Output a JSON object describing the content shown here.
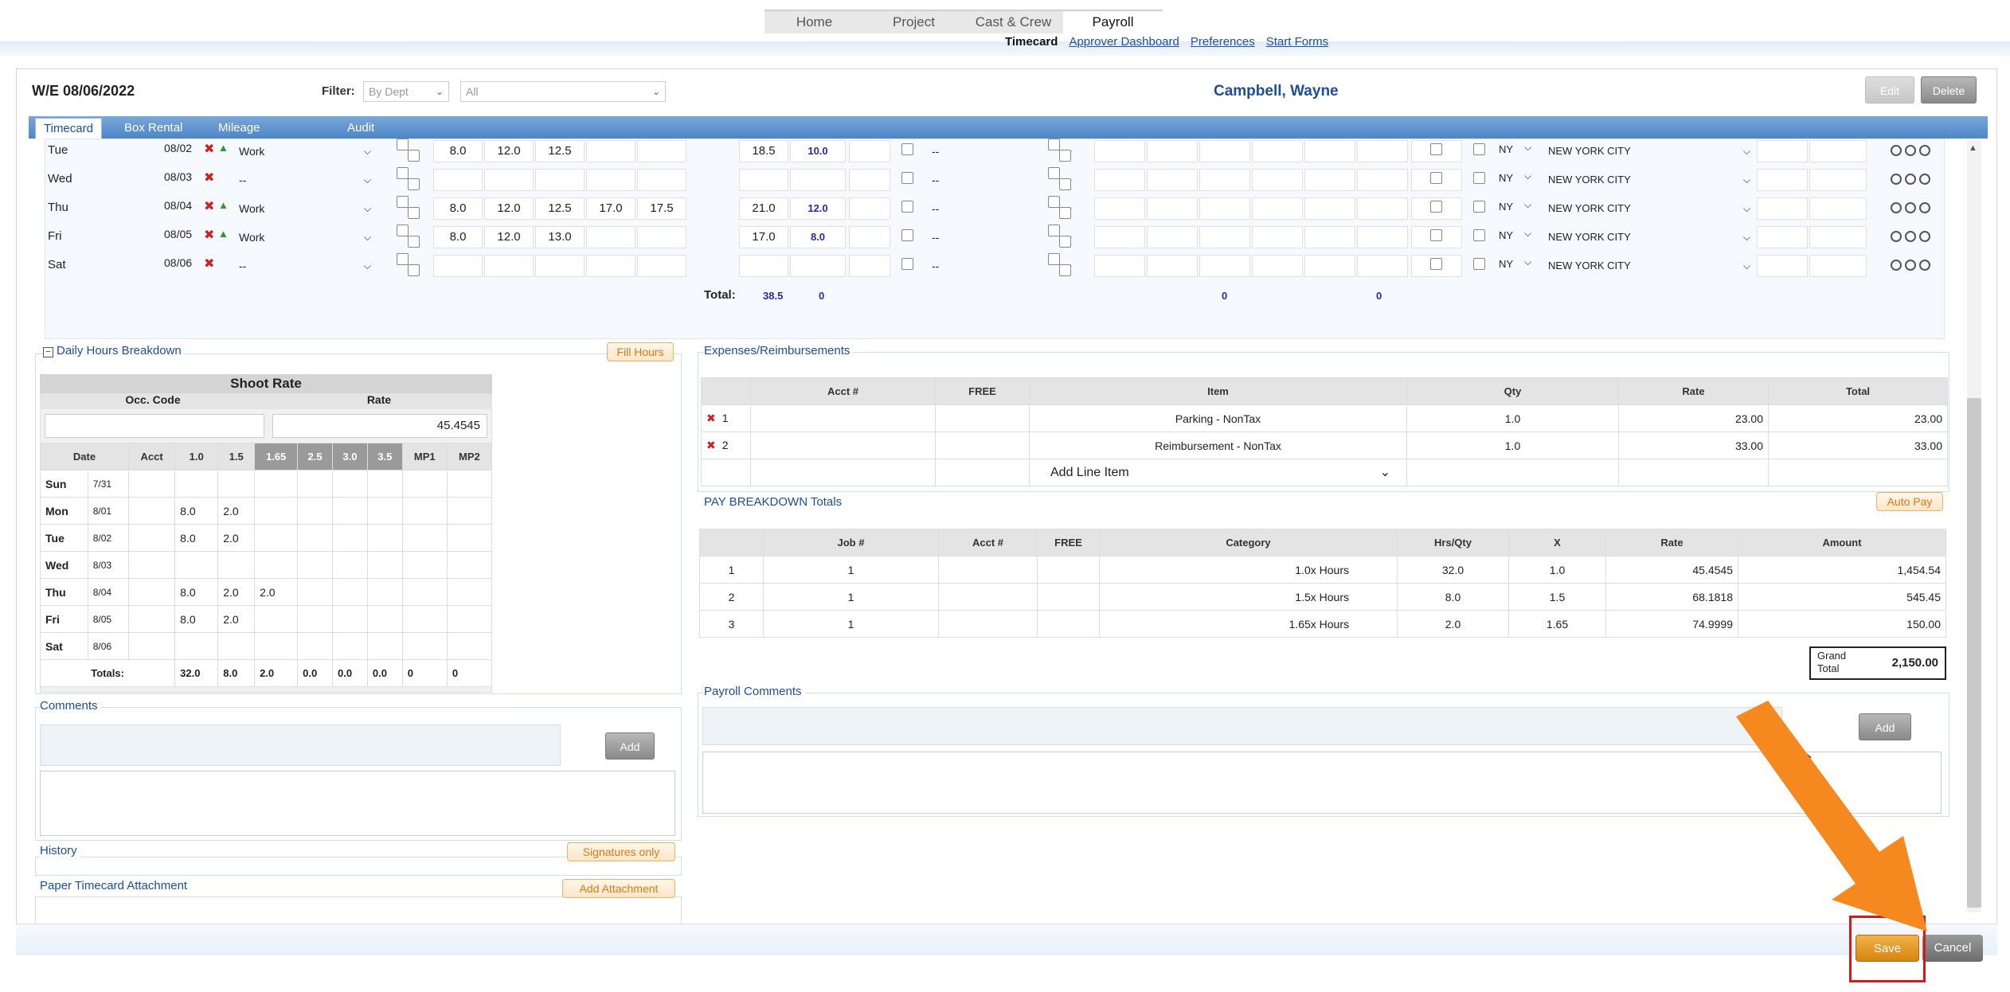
{
  "nav": {
    "main_tabs": [
      "Home",
      "Project",
      "Cast & Crew",
      "Payroll"
    ],
    "sub_tabs": [
      "Timecard",
      "Approver Dashboard",
      "Preferences",
      "Start Forms"
    ]
  },
  "header": {
    "week_ending": "W/E  08/06/2022",
    "filter_label": "Filter:",
    "filter_dept": "By Dept",
    "filter_value": "All",
    "employee_name": "Campbell, Wayne",
    "edit_label": "Edit",
    "delete_label": "Delete"
  },
  "timecard_tabs": [
    "Timecard",
    "Box Rental",
    "Mileage",
    "Audit"
  ],
  "days": [
    {
      "day": "Tue",
      "date": "08/02",
      "type": "Work",
      "t1": "8.0",
      "t2": "12.0",
      "t3": "12.5",
      "t4": "",
      "t5": "",
      "total": "18.5",
      "hrs": "10.0",
      "state": "NY",
      "city": "NEW YORK CITY",
      "type2": "--"
    },
    {
      "day": "Wed",
      "date": "08/03",
      "type": "--",
      "t1": "",
      "t2": "",
      "t3": "",
      "t4": "",
      "t5": "",
      "total": "",
      "hrs": "",
      "state": "NY",
      "city": "NEW YORK CITY",
      "type2": "--"
    },
    {
      "day": "Thu",
      "date": "08/04",
      "type": "Work",
      "t1": "8.0",
      "t2": "12.0",
      "t3": "12.5",
      "t4": "17.0",
      "t5": "17.5",
      "total": "21.0",
      "hrs": "12.0",
      "state": "NY",
      "city": "NEW YORK CITY",
      "type2": "--"
    },
    {
      "day": "Fri",
      "date": "08/05",
      "type": "Work",
      "t1": "8.0",
      "t2": "12.0",
      "t3": "13.0",
      "t4": "",
      "t5": "",
      "total": "17.0",
      "hrs": "8.0",
      "state": "NY",
      "city": "NEW YORK CITY",
      "type2": "--"
    },
    {
      "day": "Sat",
      "date": "08/06",
      "type": "--",
      "t1": "",
      "t2": "",
      "t3": "",
      "t4": "",
      "t5": "",
      "total": "",
      "hrs": "",
      "state": "NY",
      "city": "NEW YORK CITY",
      "type2": "--"
    }
  ],
  "totals_row": {
    "label": "Total:",
    "hours": "38.5",
    "a": "0",
    "b": "0",
    "c": "0"
  },
  "daily_breakdown": {
    "title": "Daily Hours Breakdown",
    "fill_hours": "Fill Hours",
    "shoot_rate": "Shoot Rate",
    "occ_code": "Occ. Code",
    "rate_label": "Rate",
    "rate_value": "45.4545",
    "columns": [
      "Date",
      "Acct",
      "1.0",
      "1.5",
      "1.65",
      "2.5",
      "3.0",
      "3.5",
      "MP1",
      "MP2"
    ],
    "rows": [
      {
        "day": "Sun",
        "date": "7/31",
        "v1": "",
        "v15": "",
        "v165": ""
      },
      {
        "day": "Mon",
        "date": "8/01",
        "v1": "8.0",
        "v15": "2.0",
        "v165": ""
      },
      {
        "day": "Tue",
        "date": "8/02",
        "v1": "8.0",
        "v15": "2.0",
        "v165": ""
      },
      {
        "day": "Wed",
        "date": "8/03",
        "v1": "",
        "v15": "",
        "v165": ""
      },
      {
        "day": "Thu",
        "date": "8/04",
        "v1": "8.0",
        "v15": "2.0",
        "v165": "2.0"
      },
      {
        "day": "Fri",
        "date": "8/05",
        "v1": "8.0",
        "v15": "2.0",
        "v165": ""
      },
      {
        "day": "Sat",
        "date": "8/06",
        "v1": "",
        "v15": "",
        "v165": ""
      }
    ],
    "totals": [
      "Totals:",
      "32.0",
      "8.0",
      "2.0",
      "0.0",
      "0.0",
      "0.0",
      "0",
      "0"
    ]
  },
  "comments": {
    "title": "Comments",
    "add": "Add"
  },
  "history": {
    "title": "History",
    "button": "Signatures only"
  },
  "attachment": {
    "title": "Paper Timecard Attachment",
    "button": "Add Attachment"
  },
  "expenses": {
    "title": "Expenses/Reimbursements",
    "columns": [
      "Acct #",
      "FREE",
      "Item",
      "Qty",
      "Rate",
      "Total"
    ],
    "rows": [
      {
        "n": "1",
        "item": "Parking - NonTax",
        "qty": "1.0",
        "rate": "23.00",
        "total": "23.00"
      },
      {
        "n": "2",
        "item": "Reimbursement - NonTax",
        "qty": "1.0",
        "rate": "33.00",
        "total": "33.00"
      }
    ],
    "add_line": "Add Line Item"
  },
  "pay_breakdown": {
    "title": "PAY BREAKDOWN Totals",
    "auto_pay": "Auto Pay",
    "columns": [
      "Job #",
      "Acct #",
      "FREE",
      "Category",
      "Hrs/Qty",
      "X",
      "Rate",
      "Amount"
    ],
    "rows": [
      {
        "n": "1",
        "job": "1",
        "category": "1.0x Hours",
        "hrs": "32.0",
        "x": "1.0",
        "rate": "45.4545",
        "amount": "1,454.54"
      },
      {
        "n": "2",
        "job": "1",
        "category": "1.5x Hours",
        "hrs": "8.0",
        "x": "1.5",
        "rate": "68.1818",
        "amount": "545.45"
      },
      {
        "n": "3",
        "job": "1",
        "category": "1.65x Hours",
        "hrs": "2.0",
        "x": "1.65",
        "rate": "74.9999",
        "amount": "150.00"
      }
    ],
    "grand_total_label": "Grand Total",
    "grand_total": "2,150.00"
  },
  "payroll_comments": {
    "title": "Payroll Comments",
    "add": "Add"
  },
  "footer": {
    "save": "Save",
    "cancel": "Cancel"
  },
  "colors": {
    "accent": "#1c4e9c",
    "save": "#e08d1a",
    "highlight": "#d21b1b",
    "arrow": "#f5891f"
  }
}
